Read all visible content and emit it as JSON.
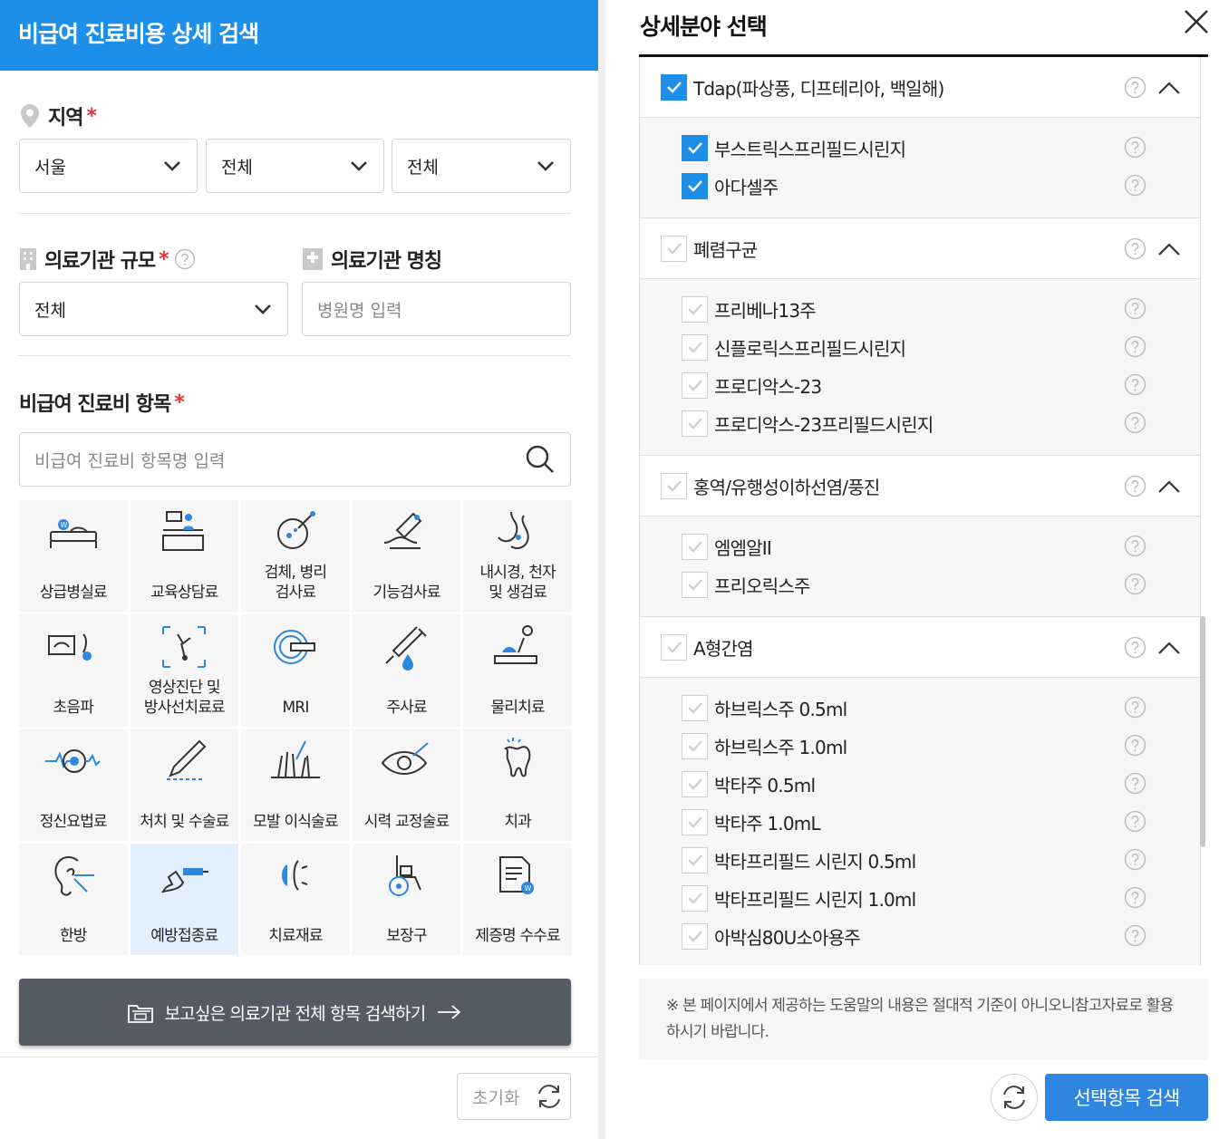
{
  "left": {
    "header_title": "비급여 진료비용 상세 검색",
    "region": {
      "label": "지역",
      "required": "*",
      "selects": [
        "서울",
        "전체",
        "전체"
      ]
    },
    "scale": {
      "label": "의료기관 규모",
      "required": "*",
      "value": "전체"
    },
    "name": {
      "label": "의료기관 명칭",
      "placeholder": "병원명 입력"
    },
    "items": {
      "label": "비급여 진료비 항목",
      "required": "*",
      "placeholder": "비급여 진료비 항목명 입력",
      "categories": [
        {
          "label": "상급병실료",
          "icon": "hospital-bed-icon"
        },
        {
          "label": "교육상담료",
          "icon": "counseling-icon"
        },
        {
          "label": "검체, 병리\n검사료",
          "icon": "petri-dish-icon"
        },
        {
          "label": "기능검사료",
          "icon": "thermometer-icon"
        },
        {
          "label": "내시경, 천자\n및 생검료",
          "icon": "stomach-icon"
        },
        {
          "label": "초음파",
          "icon": "ultrasound-icon"
        },
        {
          "label": "영상진단 및\n방사선치료료",
          "icon": "xray-bone-icon"
        },
        {
          "label": "MRI",
          "icon": "mri-icon"
        },
        {
          "label": "주사료",
          "icon": "syringe-icon"
        },
        {
          "label": "물리치료",
          "icon": "physiotherapy-icon"
        },
        {
          "label": "정신요법료",
          "icon": "brain-wave-icon"
        },
        {
          "label": "처치 및 수술료",
          "icon": "scalpel-icon"
        },
        {
          "label": "모발 이식술료",
          "icon": "hair-transplant-icon"
        },
        {
          "label": "시력 교정술료",
          "icon": "eye-laser-icon"
        },
        {
          "label": "치과",
          "icon": "tooth-icon"
        },
        {
          "label": "한방",
          "icon": "acupuncture-ear-icon"
        },
        {
          "label": "예방접종료",
          "icon": "vaccine-icon"
        },
        {
          "label": "치료재료",
          "icon": "lens-icon"
        },
        {
          "label": "보장구",
          "icon": "wheelchair-icon"
        },
        {
          "label": "제증명 수수료",
          "icon": "certificate-icon"
        }
      ],
      "active_index": 16
    },
    "search_all_label": "보고싶은 의료기관 전체 항목 검색하기",
    "reset_label": "초기화"
  },
  "right": {
    "title": "상세분야 선택",
    "groups": [
      {
        "label": "Tdap(파상풍, 디프테리아, 백일해)",
        "checked": true,
        "items": [
          {
            "label": "부스트릭스프리필드시린지",
            "checked": true
          },
          {
            "label": "아다셀주",
            "checked": true
          }
        ]
      },
      {
        "label": "폐렴구균",
        "checked": false,
        "items": [
          {
            "label": "프리베나13주",
            "checked": false
          },
          {
            "label": "신플로릭스프리필드시린지",
            "checked": false
          },
          {
            "label": "프로디악스-23",
            "checked": false
          },
          {
            "label": "프로디악스-23프리필드시린지",
            "checked": false
          }
        ]
      },
      {
        "label": "홍역/유행성이하선염/풍진",
        "checked": false,
        "items": [
          {
            "label": "엠엠알II",
            "checked": false
          },
          {
            "label": "프리오릭스주",
            "checked": false
          }
        ]
      },
      {
        "label": "A형간염",
        "checked": false,
        "items": [
          {
            "label": "하브릭스주 0.5ml",
            "checked": false
          },
          {
            "label": "하브릭스주 1.0ml",
            "checked": false
          },
          {
            "label": "박타주 0.5ml",
            "checked": false
          },
          {
            "label": "박타주 1.0mL",
            "checked": false
          },
          {
            "label": "박타프리필드 시린지 0.5ml",
            "checked": false
          },
          {
            "label": "박타프리필드 시린지 1.0ml",
            "checked": false
          },
          {
            "label": "아박심80U소아용주",
            "checked": false
          }
        ]
      }
    ],
    "notice": "※ 본 페이지에서 제공하는 도움말의 내용은 절대적 기준이 아니오니참고자료로 활용하시기 바랍니다.",
    "search_label": "선택항목 검색"
  },
  "colors": {
    "brand": "#1e8fe8",
    "dark_button": "#555a64",
    "required": "#e6323c",
    "search_button": "#2f86e0"
  }
}
